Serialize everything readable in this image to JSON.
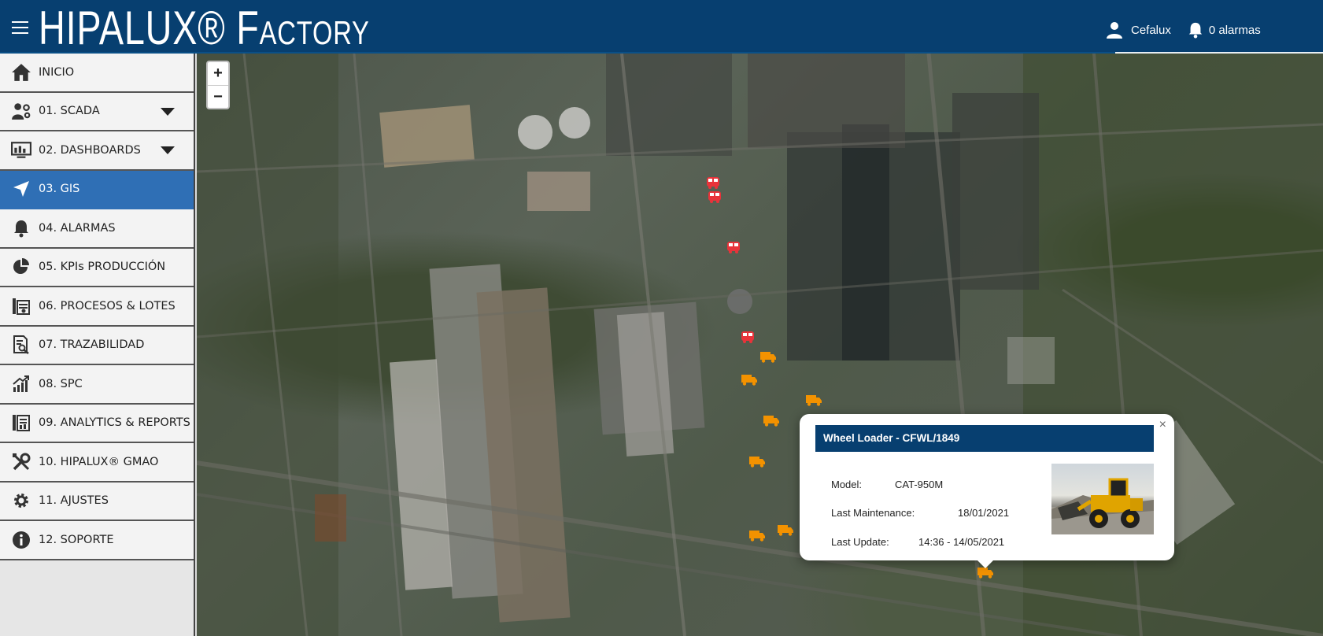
{
  "header": {
    "brand_main": "HIPALUX®",
    "brand_factory": "Factory",
    "user_name": "Cefalux",
    "alarms_label": "0 alarmas"
  },
  "sidebar": {
    "items": [
      {
        "label": "INICIO",
        "icon": "home-icon"
      },
      {
        "label": "01. SCADA",
        "icon": "scada-icon",
        "expandable": true
      },
      {
        "label": "02. DASHBOARDS",
        "icon": "dashboard-icon",
        "expandable": true
      },
      {
        "label": "03. GIS",
        "icon": "navigation-arrow-icon",
        "active": true
      },
      {
        "label": "04. ALARMAS",
        "icon": "bell-icon"
      },
      {
        "label": "05. KPIs PRODUCCIÓN",
        "icon": "pie-chart-icon"
      },
      {
        "label": "06. PROCESOS & LOTES",
        "icon": "process-icon"
      },
      {
        "label": "07. TRAZABILIDAD",
        "icon": "trace-document-icon"
      },
      {
        "label": "08. SPC",
        "icon": "trend-chart-icon"
      },
      {
        "label": "09. ANALYTICS & REPORTS",
        "icon": "report-icon"
      },
      {
        "label": "10. HIPALUX® GMAO",
        "icon": "tools-icon"
      },
      {
        "label": "11. AJUSTES",
        "icon": "gear-icon"
      },
      {
        "label": "12. SOPORTE",
        "icon": "info-icon"
      }
    ]
  },
  "map": {
    "zoom_in": "+",
    "zoom_out": "−",
    "popup": {
      "close": "×",
      "title": "Wheel Loader - CFWL/1849",
      "model_label": "Model:",
      "model_value": "CAT-950M",
      "maintenance_label": "Last Maintenance:",
      "maintenance_value": "18/01/2021",
      "update_label": "Last Update:",
      "update_value": "14:36 - 14/05/2021"
    }
  },
  "colors": {
    "header_bg": "#073f70",
    "active_item": "#2f6fb5",
    "bus_marker": "#e8333a",
    "truck_marker": "#f39200"
  }
}
